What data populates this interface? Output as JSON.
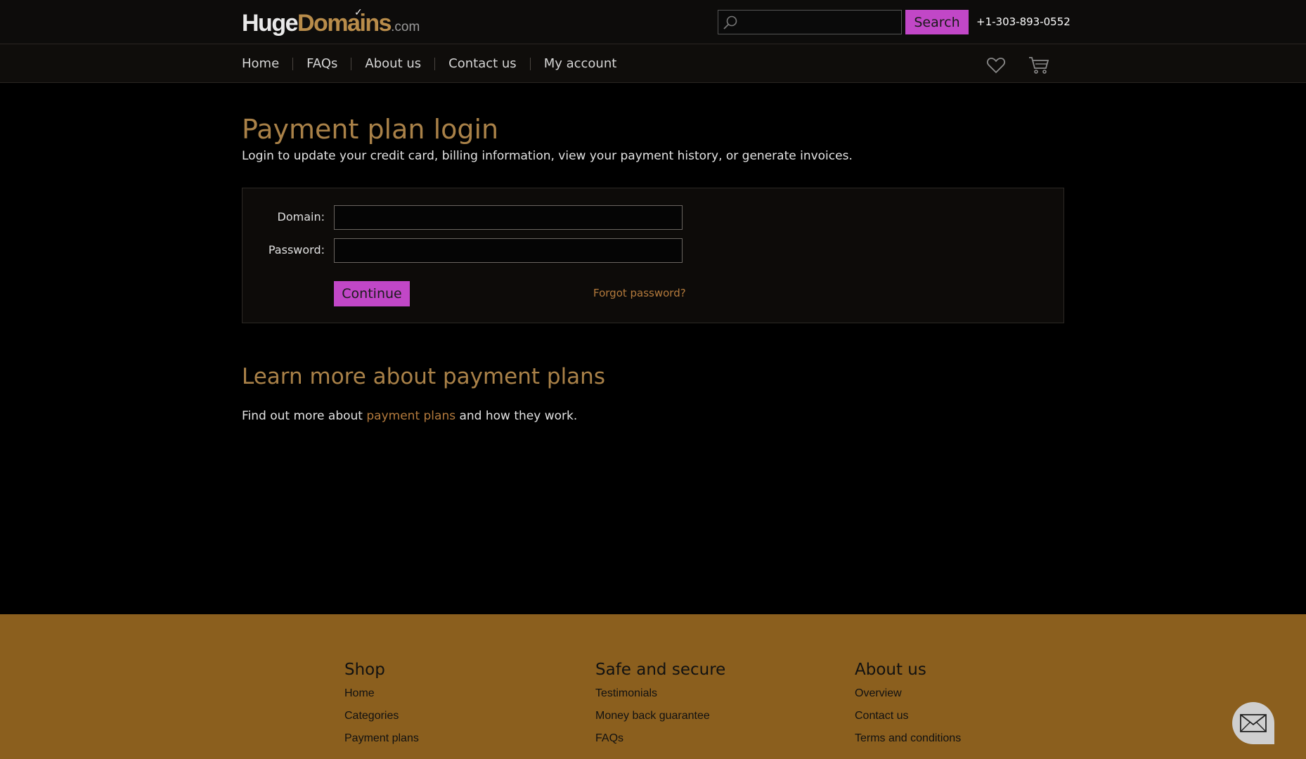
{
  "header": {
    "logo": {
      "part1": "Huge",
      "part2": "Domains",
      "part3": ".com"
    },
    "search": {
      "placeholder": "",
      "button_label": "Search"
    },
    "phone": "+1-303-893-0552"
  },
  "nav": {
    "items": [
      {
        "label": "Home"
      },
      {
        "label": "FAQs"
      },
      {
        "label": "About us"
      },
      {
        "label": "Contact us"
      },
      {
        "label": "My account"
      }
    ],
    "icons": [
      "heart-icon",
      "cart-icon"
    ]
  },
  "main": {
    "title": "Payment plan login",
    "intro": "Login to update your credit card, billing information, view your payment history, or generate invoices.",
    "form": {
      "domain_label": "Domain:",
      "domain_value": "",
      "password_label": "Password:",
      "password_value": "",
      "continue_label": "Continue",
      "forgot_label": "Forgot password?"
    },
    "learn": {
      "heading": "Learn more about payment plans",
      "text_before": "Find out more about ",
      "link": "payment plans",
      "text_after": " and how they work."
    }
  },
  "footer": {
    "columns": [
      {
        "title": "Shop",
        "links": [
          "Home",
          "Categories",
          "Payment plans"
        ]
      },
      {
        "title": "Safe and secure",
        "links": [
          "Testimonials",
          "Money back guarantee",
          "FAQs"
        ]
      },
      {
        "title": "About us",
        "links": [
          "Overview",
          "Contact us",
          "Terms and conditions"
        ]
      }
    ]
  },
  "colors": {
    "accent": "#c147c7",
    "heading": "#a98148",
    "link": "#b37a3c",
    "footer_bg": "#8b5f1e"
  }
}
